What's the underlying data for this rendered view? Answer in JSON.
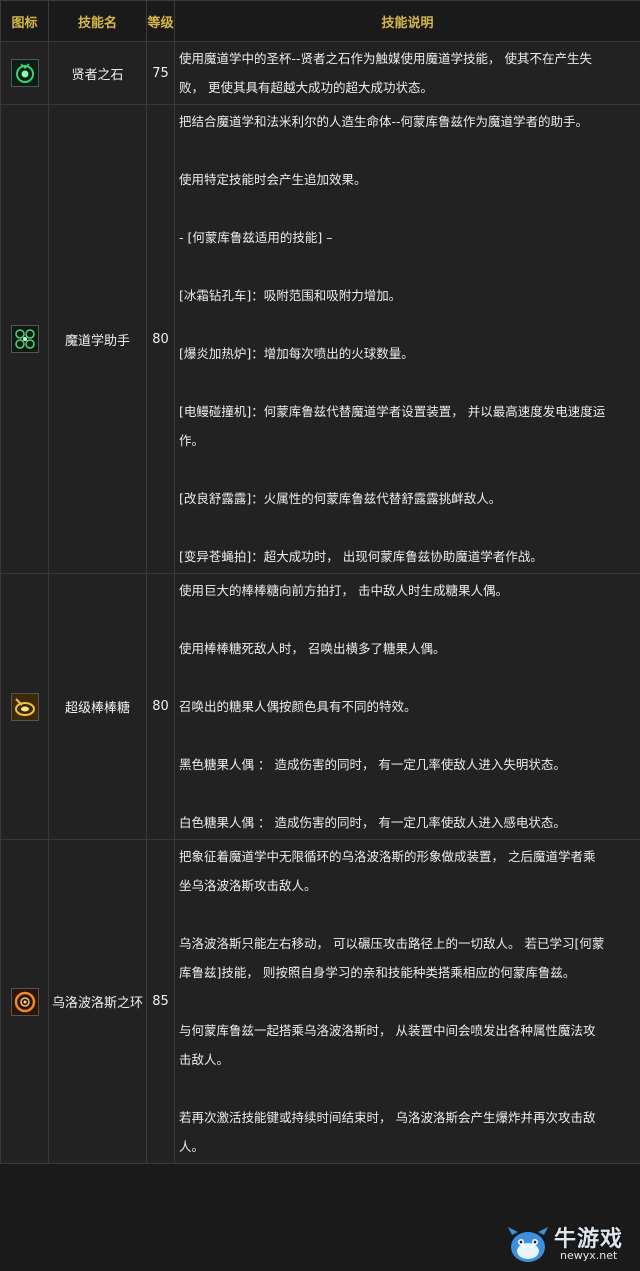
{
  "header": {
    "icon": "图标",
    "name": "技能名",
    "level": "等级",
    "desc": "技能说明"
  },
  "skills": [
    {
      "icon": "sage-stone-icon",
      "name": "贤者之石",
      "level": "75",
      "lines": [
        "使用魔道学中的圣杯--贤者之石作为触媒使用魔道学技能， 使其不在产生失",
        "败， 更使其具有超越大成功的超大成功状态。"
      ]
    },
    {
      "icon": "homunculus-icon",
      "name": "魔道学助手",
      "level": "80",
      "lines": [
        "把结合魔道学和法米利尔的人造生命体--何蒙库鲁兹作为魔道学者的助手。",
        "",
        "使用特定技能时会产生追加效果。",
        "",
        "- [何蒙库鲁兹适用的技能] –",
        "",
        "[冰霜钻孔车]：吸附范围和吸附力增加。",
        "",
        "[爆炎加热炉]：增加每次喷出的火球数量。",
        "",
        "[电鳗碰撞机]：何蒙库鲁兹代替魔道学者设置装置， 并以最高速度发电速度运",
        "作。",
        "",
        "[改良舒露露]：火属性的何蒙库鲁兹代替舒露露挑衅敌人。",
        "",
        "[变异苍蝇拍]：超大成功时， 出现何蒙库鲁兹协助魔道学者作战。"
      ]
    },
    {
      "icon": "candy-stick-icon",
      "name": "超级棒棒糖",
      "level": "80",
      "lines": [
        "使用巨大的棒棒糖向前方拍打， 击中敌人时生成糖果人偶。",
        "",
        "使用棒棒糖死敌人时， 召唤出横多了糖果人偶。",
        "",
        "召唤出的糖果人偶按颜色具有不同的特效。",
        "",
        "黑色糖果人偶 ： 造成伤害的同时， 有一定几率使敌人进入失明状态。",
        "",
        "白色糖果人偶 ： 造成伤害的同时， 有一定几率使敌人进入感电状态。"
      ]
    },
    {
      "icon": "ouroboros-ring-icon",
      "name": "乌洛波洛斯之环",
      "level": "85",
      "lines": [
        "把象征着魔道学中无限循环的乌洛波洛斯的形象做成装置， 之后魔道学者乘",
        "坐乌洛波洛斯攻击敌人。",
        "",
        "乌洛波洛斯只能左右移动， 可以碾压攻击路径上的一切敌人。 若已学习[何蒙",
        "库鲁兹]技能， 则按照自身学习的亲和技能种类搭乘相应的何蒙库鲁兹。",
        "",
        "与何蒙库鲁兹一起搭乘乌洛波洛斯时， 从装置中间会喷发出各种属性魔法攻",
        "击敌人。",
        "",
        "若再次激活技能键或持续时间结束时， 乌洛波洛斯会产生爆炸并再次攻击敌",
        "人。"
      ]
    }
  ],
  "watermark": {
    "text": "牛游戏",
    "url": "newyx.net",
    "icon": "mascot-icon"
  }
}
